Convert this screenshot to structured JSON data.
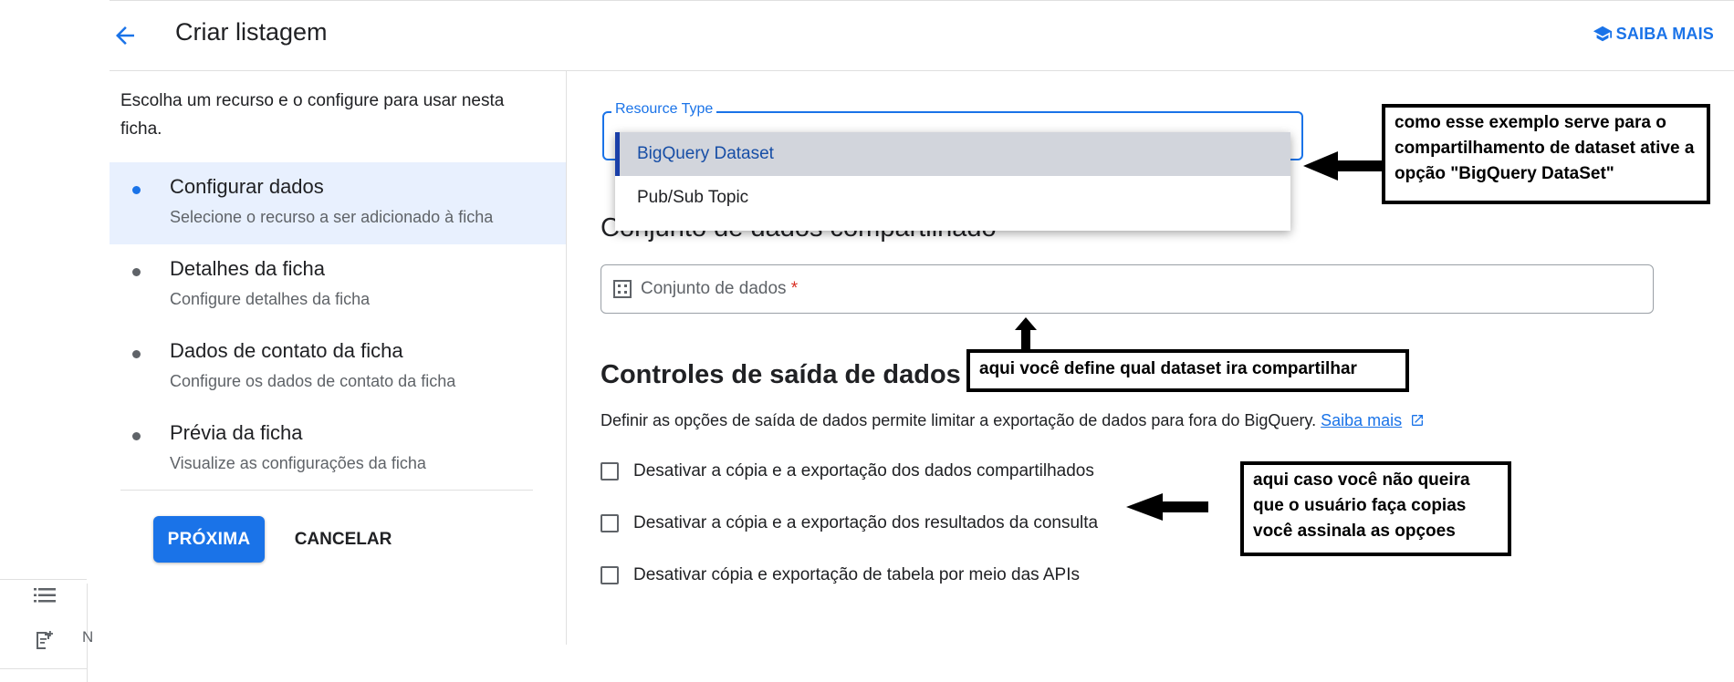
{
  "header": {
    "back_icon": "arrow-back-icon",
    "title": "Criar listagem",
    "learn_more_icon": "school-icon",
    "learn_more_label": "SAIBA MAIS"
  },
  "sidebar": {
    "description": "Escolha um recurso e o configure para usar nesta ficha.",
    "steps": [
      {
        "title": "Configurar dados",
        "subtitle": "Selecione o recurso a ser adicionado à ficha",
        "active": true
      },
      {
        "title": "Detalhes da ficha",
        "subtitle": "Configure detalhes da ficha",
        "active": false
      },
      {
        "title": "Dados de contato da ficha",
        "subtitle": "Configure os dados de contato da ficha",
        "active": false
      },
      {
        "title": "Prévia da ficha",
        "subtitle": "Visualize as configurações da ficha",
        "active": false
      }
    ],
    "next_label": "PRÓXIMA",
    "cancel_label": "CANCELAR"
  },
  "rail": {
    "icons": [
      "list-icon",
      "note-add-icon"
    ],
    "truncated_letter": "N"
  },
  "main": {
    "resource_type_label": "Resource Type",
    "resource_options": [
      "BigQuery Dataset",
      "Pub/Sub Topic"
    ],
    "selected_option": "BigQuery Dataset",
    "shared_dataset_heading": "Conjunto de dados compartilhado",
    "dataset_field_placeholder": "Conjunto de dados",
    "dataset_required_mark": "*",
    "dataset_icon": "dataset-grid-icon",
    "egress_heading": "Controles de saída de dados",
    "egress_description": "Definir as opções de saída de dados permite limitar a exportação de dados para fora do BigQuery.",
    "egress_link": "Saiba mais",
    "egress_link_icon": "open-in-new-icon",
    "checkboxes": [
      {
        "label": "Desativar a cópia e a exportação dos dados compartilhados",
        "checked": false
      },
      {
        "label": "Desativar a cópia e a exportação dos resultados da consulta",
        "checked": false
      },
      {
        "label": "Desativar cópia e exportação de tabela por meio das APIs",
        "checked": false
      }
    ]
  },
  "annotations": {
    "note1": "como esse exemplo serve para o compartilhamento de dataset ative a opção \"BigQuery DataSet\"",
    "note2": "aqui você define qual dataset ira compartilhar",
    "note3": "aqui caso você não queira que o usuário faça copias você assinala as opçoes"
  },
  "colors": {
    "accent": "#1a73e8",
    "active_step_bg": "#e8f0fe",
    "selected_option_bg": "#d2d5dc",
    "required": "#d93025"
  }
}
